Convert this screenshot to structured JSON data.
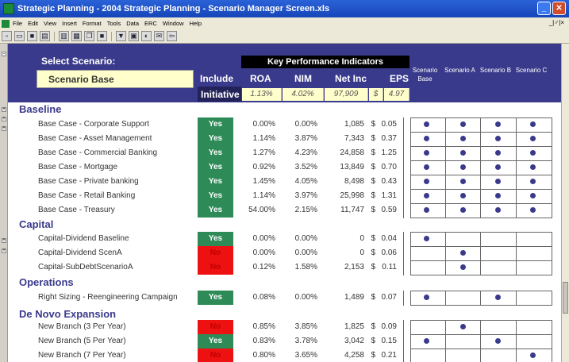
{
  "window": {
    "title": "Strategic Planning - 2004 Strategic Planning - Scenario Manager Screen.xls",
    "restore_label": "_",
    "close_label": "✕"
  },
  "menu": [
    "File",
    "Edit",
    "View",
    "Insert",
    "Format",
    "Tools",
    "Data",
    "ERC",
    "Window",
    "Help"
  ],
  "menu_right": "_|♂|×",
  "header": {
    "select_label": "Select Scenario:",
    "selected_scenario": "Scenario Base",
    "include_label": "Include",
    "initiative_label": "Initiative",
    "kpi_title": "Key Performance Indicators",
    "kpi_columns": [
      "ROA",
      "NIM",
      "Net Inc",
      "EPS"
    ],
    "kpi_values": [
      "1.13%",
      "4.02%",
      "97,909",
      "$",
      "4.97"
    ],
    "scenarios": [
      "Scenario Base",
      "Scenario A",
      "Scenario B",
      "Scenario C"
    ]
  },
  "sections": [
    {
      "title": "Baseline",
      "rows": [
        {
          "label": "Base Case - Corporate Support",
          "include": "Yes",
          "roa": "0.00%",
          "nim": "0.00%",
          "netinc": "1,085",
          "cur": "$",
          "eps": "0.05",
          "dots": [
            1,
            1,
            1,
            1
          ]
        },
        {
          "label": "Base Case - Asset Management",
          "include": "Yes",
          "roa": "1.14%",
          "nim": "3.87%",
          "netinc": "7,343",
          "cur": "$",
          "eps": "0.37",
          "dots": [
            1,
            1,
            1,
            1
          ]
        },
        {
          "label": "Base Case - Commercial Banking",
          "include": "Yes",
          "roa": "1.27%",
          "nim": "4.23%",
          "netinc": "24,858",
          "cur": "$",
          "eps": "1.25",
          "dots": [
            1,
            1,
            1,
            1
          ]
        },
        {
          "label": "Base Case - Mortgage",
          "include": "Yes",
          "roa": "0.92%",
          "nim": "3.52%",
          "netinc": "13,849",
          "cur": "$",
          "eps": "0.70",
          "dots": [
            1,
            1,
            1,
            1
          ]
        },
        {
          "label": "Base Case - Private banking",
          "include": "Yes",
          "roa": "1.45%",
          "nim": "4.05%",
          "netinc": "8,498",
          "cur": "$",
          "eps": "0.43",
          "dots": [
            1,
            1,
            1,
            1
          ]
        },
        {
          "label": "Base Case - Retail Banking",
          "include": "Yes",
          "roa": "1.14%",
          "nim": "3.97%",
          "netinc": "25,998",
          "cur": "$",
          "eps": "1.31",
          "dots": [
            1,
            1,
            1,
            1
          ]
        },
        {
          "label": "Base Case - Treasury",
          "include": "Yes",
          "roa": "54.00%",
          "nim": "2.15%",
          "netinc": "11,747",
          "cur": "$",
          "eps": "0.59",
          "dots": [
            1,
            1,
            1,
            1
          ]
        }
      ]
    },
    {
      "title": "Capital",
      "rows": [
        {
          "label": "Capital-Dividend Baseline",
          "include": "Yes",
          "roa": "0.00%",
          "nim": "0.00%",
          "netinc": "0",
          "cur": "$",
          "eps": "0.04",
          "dots": [
            1,
            0,
            0,
            0
          ]
        },
        {
          "label": "Capital-Dividend ScenA",
          "include": "No",
          "roa": "0.00%",
          "nim": "0.00%",
          "netinc": "0",
          "cur": "$",
          "eps": "0.06",
          "dots": [
            0,
            1,
            0,
            0
          ]
        },
        {
          "label": "Capital-SubDebtScenarioA",
          "include": "No",
          "roa": "0.12%",
          "nim": "1.58%",
          "netinc": "2,153",
          "cur": "$",
          "eps": "0.11",
          "dots": [
            0,
            1,
            0,
            0
          ]
        }
      ]
    },
    {
      "title": "Operations",
      "rows": [
        {
          "label": "Right Sizing - Reengineering Campaign",
          "include": "Yes",
          "roa": "0.08%",
          "nim": "0.00%",
          "netinc": "1,489",
          "cur": "$",
          "eps": "0.07",
          "dots": [
            1,
            0,
            1,
            0
          ]
        }
      ]
    },
    {
      "title": "De Novo Expansion",
      "rows": [
        {
          "label": "New Branch (3 Per Year)",
          "include": "No",
          "roa": "0.85%",
          "nim": "3.85%",
          "netinc": "1,825",
          "cur": "$",
          "eps": "0.09",
          "dots": [
            0,
            1,
            0,
            0
          ]
        },
        {
          "label": "New Branch (5 Per Year)",
          "include": "Yes",
          "roa": "0.83%",
          "nim": "3.78%",
          "netinc": "3,042",
          "cur": "$",
          "eps": "0.15",
          "dots": [
            1,
            0,
            1,
            0
          ]
        },
        {
          "label": "New Branch (7 Per Year)",
          "include": "No",
          "roa": "0.80%",
          "nim": "3.65%",
          "netinc": "4,258",
          "cur": "$",
          "eps": "0.21",
          "dots": [
            0,
            0,
            0,
            1
          ]
        }
      ]
    }
  ],
  "colors": {
    "header": "#3a3a8c",
    "yes": "#2e8b57",
    "no": "#ee1111",
    "input": "#ffffcc"
  }
}
